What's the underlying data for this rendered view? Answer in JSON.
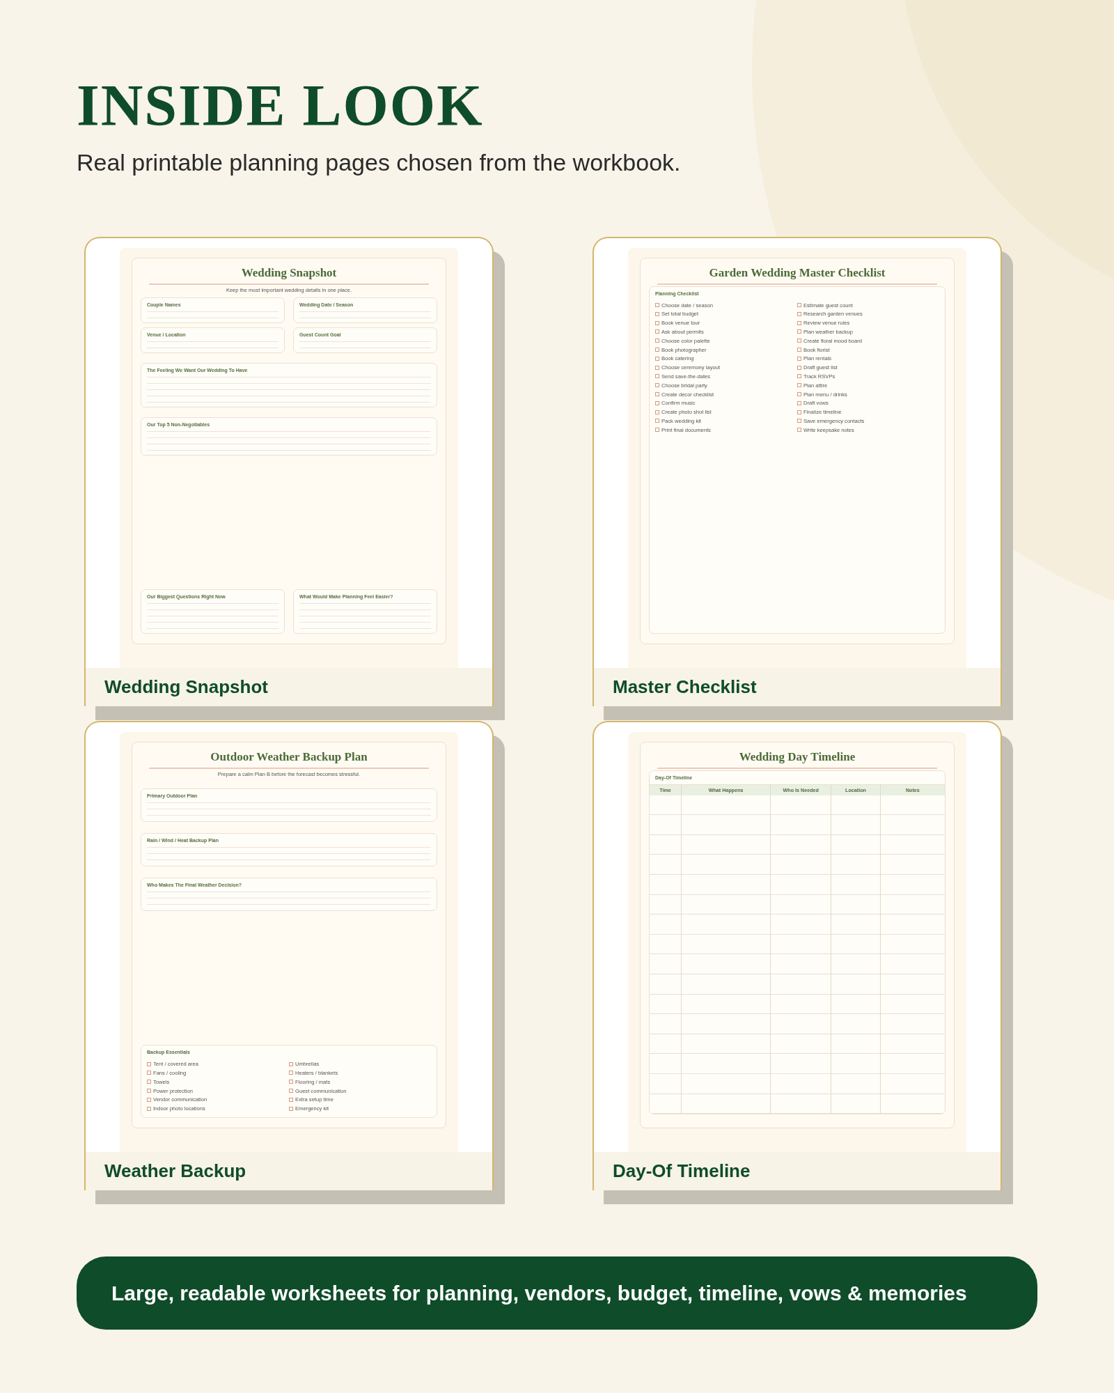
{
  "header": {
    "title": "INSIDE LOOK",
    "subtitle": "Real printable planning pages chosen from the workbook."
  },
  "pages": [
    {
      "caption": "Wedding Snapshot",
      "title": "Wedding Snapshot",
      "subtitle": "Keep the most important wedding details in one place.",
      "blocks": [
        {
          "kind": "pair",
          "labels": [
            "Couple Names",
            "Wedding Date / Season"
          ]
        },
        {
          "kind": "pair",
          "labels": [
            "Venue / Location",
            "Guest Count Goal"
          ]
        },
        {
          "kind": "wide_l",
          "label": "The Feeling We Want Our Wedding To Have"
        },
        {
          "kind": "wide",
          "label": "Our Top 5 Non-Negotiables"
        },
        {
          "kind": "gap"
        },
        {
          "kind": "pair_tall",
          "labels": [
            "Our Biggest Questions Right Now",
            "What Would Make Planning Feel Easier?"
          ]
        }
      ]
    },
    {
      "caption": "Master Checklist",
      "title": "Garden Wedding Master Checklist",
      "blocks": [
        {
          "kind": "checklist",
          "label": "Planning Checklist",
          "columns": [
            [
              {
                "text": "Choose date / season",
                "checked": false
              },
              {
                "text": "Set total budget",
                "checked": false
              },
              {
                "text": "Book venue tour",
                "checked": false
              },
              {
                "text": "Ask about permits",
                "checked": false
              },
              {
                "text": "Choose color palette",
                "checked": false
              },
              {
                "text": "Book photographer",
                "checked": false
              },
              {
                "text": "Book catering",
                "checked": false
              },
              {
                "text": "Choose ceremony layout",
                "checked": false
              },
              {
                "text": "Send save-the-dates",
                "checked": false
              },
              {
                "text": "Choose bridal party",
                "checked": false
              },
              {
                "text": "Create decor checklist",
                "checked": false
              },
              {
                "text": "Confirm music",
                "checked": false
              },
              {
                "text": "Create photo shot list",
                "checked": false
              },
              {
                "text": "Pack wedding kit",
                "checked": false
              },
              {
                "text": "Print final documents",
                "checked": false
              }
            ],
            [
              {
                "text": "Estimate guest count",
                "checked": false
              },
              {
                "text": "Research garden venues",
                "checked": false
              },
              {
                "text": "Review venue rules",
                "checked": false
              },
              {
                "text": "Plan weather backup",
                "checked": false
              },
              {
                "text": "Create floral mood board",
                "checked": false
              },
              {
                "text": "Book florist",
                "checked": false
              },
              {
                "text": "Plan rentals",
                "checked": false
              },
              {
                "text": "Draft guest list",
                "checked": false
              },
              {
                "text": "Track RSVPs",
                "checked": false
              },
              {
                "text": "Plan attire",
                "checked": false
              },
              {
                "text": "Plan menu / drinks",
                "checked": false
              },
              {
                "text": "Draft vows",
                "checked": false
              },
              {
                "text": "Finalize timeline",
                "checked": false
              },
              {
                "text": "Save emergency contacts",
                "checked": false
              },
              {
                "text": "Write keepsake notes",
                "checked": false
              }
            ]
          ]
        }
      ]
    },
    {
      "caption": "Weather Backup",
      "title": "Outdoor Weather Backup Plan",
      "subtitle": "Prepare a calm Plan B before the forecast becomes stressful.",
      "blocks": [
        {
          "kind": "wide_s",
          "label": "Primary Outdoor Plan"
        },
        {
          "kind": "wide_s",
          "label": "Rain / Wind / Heat Backup Plan"
        },
        {
          "kind": "wide_s",
          "label": "Who Makes The Final Weather Decision?"
        },
        {
          "kind": "gap"
        },
        {
          "kind": "checklist",
          "label": "Backup Essentials",
          "columns": [
            [
              {
                "text": "Tent / covered area",
                "checked": false
              },
              {
                "text": "Fans / cooling",
                "checked": false
              },
              {
                "text": "Towels",
                "checked": false
              },
              {
                "text": "Power protection",
                "checked": false
              },
              {
                "text": "Vendor communication",
                "checked": false
              },
              {
                "text": "Indoor photo locations",
                "checked": false
              }
            ],
            [
              {
                "text": "Umbrellas",
                "checked": false
              },
              {
                "text": "Heaters / blankets",
                "checked": false
              },
              {
                "text": "Flooring / mats",
                "checked": false
              },
              {
                "text": "Guest communication",
                "checked": false
              },
              {
                "text": "Extra setup time",
                "checked": false
              },
              {
                "text": "Emergency kit",
                "checked": false
              }
            ]
          ]
        }
      ]
    },
    {
      "caption": "Day-Of Timeline",
      "title": "Wedding Day Timeline",
      "blocks": [
        {
          "kind": "table",
          "label": "Day-Of Timeline",
          "columns": [
            "Time",
            "What Happens",
            "Who Is Needed",
            "Location",
            "Notes"
          ]
        }
      ]
    }
  ],
  "banner": "Large, readable worksheets for planning, vendors, budget, timeline, vows & memories"
}
